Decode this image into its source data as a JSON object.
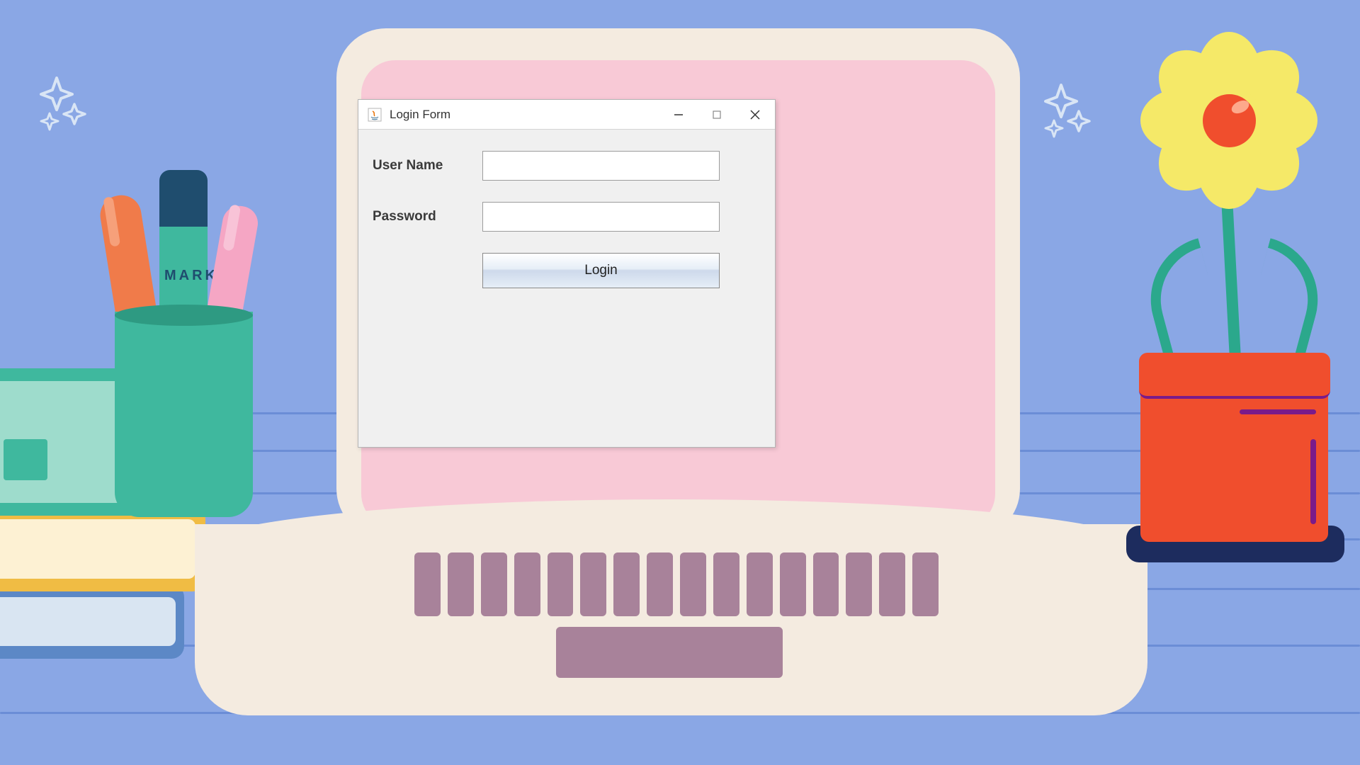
{
  "window": {
    "title": "Login Form",
    "icon": "java-icon"
  },
  "form": {
    "username_label": "User Name",
    "username_value": "",
    "password_label": "Password",
    "password_value": "",
    "login_button": "Login"
  },
  "decorations": {
    "marker_text": "MARK"
  },
  "colors": {
    "background": "#8aa7e5",
    "laptop_body": "#f4ebe0",
    "laptop_screen": "#f8c9d6",
    "keyboard": "#a8829a",
    "teal": "#3fb89e",
    "orange": "#f07b4a",
    "pot": "#f04e2d",
    "flower_petal": "#f5e968"
  }
}
